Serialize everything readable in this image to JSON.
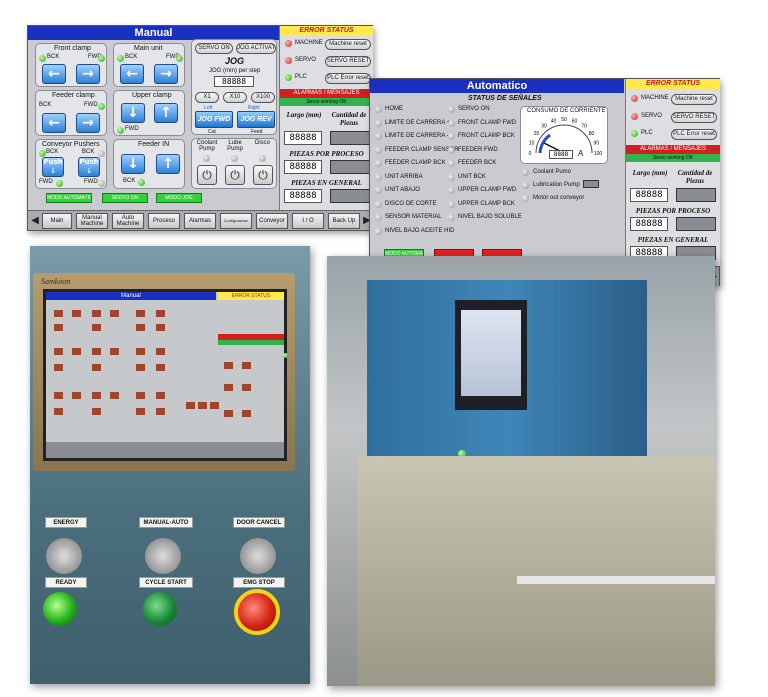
{
  "manual": {
    "title": "Manual",
    "front_clamp": "Front clamp",
    "main_unit": "Main unit",
    "feeder_clamp": "Feeder clamp",
    "upper_clamp": "Upper clamp",
    "conveyor_pushers": "Conveyor Pushers",
    "feeder_in": "Feeder IN",
    "bck": "BCK",
    "fwd": "FWD",
    "push": "Push",
    "servo_on": "SERVO ON",
    "jog_activated": "JOG ACTIVATED",
    "jog": "JOG",
    "jog_mm": "JOG (mm) per step",
    "jog_value": "88888",
    "x1": "X1",
    "x10": "X10",
    "x100": "X100",
    "left": "Left",
    "right": "Right",
    "jog_fwd": "JOG FWD",
    "jog_rev": "JOG REV",
    "cut": "Cut",
    "feed": "Feed",
    "coolant": "Coolant Pump",
    "lube": "Lube Pump",
    "disco": "Disco",
    "modo": "MODO AUTOMATICO",
    "servo_on_btn": "SERVO ON",
    "modo_jog": "MODO JOG"
  },
  "error_panel": {
    "title": "ERROR STATUS",
    "machine": "MACHINE",
    "machine_reset": "Machine reset",
    "servo": "SERVO",
    "servo_reset": "SERVO RESET",
    "plc": "PLC",
    "plc_reset": "PLC Error reset",
    "alarmas": "ALARMAS / MENSAJES",
    "servo_ok": "Servo working OK",
    "largo": "Largo (mm)",
    "cantidad": "Cantidad de Piezas",
    "num": "88888",
    "piezas_proceso": "PIEZAS POR PROCESO",
    "piezas_general": "PIEZAS EN GENERAL"
  },
  "auto": {
    "title": "Automatico",
    "status_title": "STATUS DE SEÑALES",
    "col1": [
      "HOME",
      "LIMITE DE CARRERA +",
      "LIMITE DE CARRERA -",
      "FEEDER CLAMP SENSOR",
      "FEEDER CLAMP BCK",
      "UNIT ARRIBA",
      "UNIT ABAJO",
      "DISCO DE CORTE",
      "SENSOR MATERIAL",
      "NIVEL BAJO ACEITE HID"
    ],
    "col2": [
      "SERVO ON",
      "FRONT CLAMP FWD",
      "FRONT CLAMP BCK",
      "FEEDER FWD",
      "FEEDER BCK",
      "UNIT BCK",
      "UPPER CLAMP FWD",
      "UPPER CLAMP BCK",
      "NIVEL BAJO SOLUBLE"
    ],
    "consumo": "CONSUMO DE CORRIENTE",
    "gauge_ticks": [
      "0",
      "10",
      "20",
      "30",
      "40",
      "50",
      "60",
      "70",
      "80",
      "90",
      "100"
    ],
    "gauge_value": "8888",
    "gauge_unit": "A",
    "coolant": "Coolant Pumo",
    "lubrication": "Lubrication Pump",
    "motor": "Motor out conveyor",
    "modo": "MODO AUTOMATICO"
  },
  "nav": [
    "Main",
    "Manual Machine",
    "Auto Machine",
    "Proceso",
    "Alarmas",
    "Configuracion",
    "Conveyor",
    "I / O",
    "Back Up"
  ],
  "photo": {
    "brand": "Samkoon",
    "mini_title": "Manual",
    "mini_error": "ERROR STATUS",
    "energy": "ENERGY",
    "manual_auto": "MANUAL-AUTO",
    "door_cancel": "DOOR CANCEL",
    "ready": "READY",
    "cycle_start": "CYCLE START",
    "emg_stop": "EMG STOP"
  }
}
